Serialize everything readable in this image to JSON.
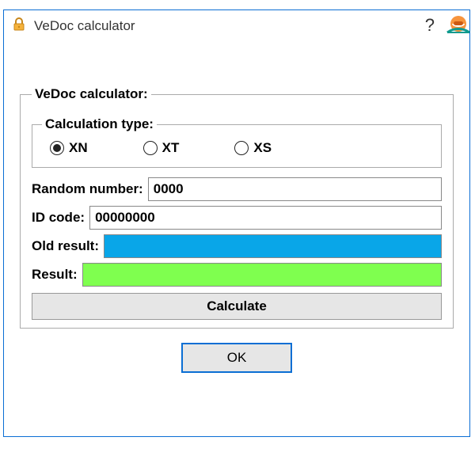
{
  "window": {
    "title": "VeDoc calculator",
    "help": "?"
  },
  "group": {
    "legend": "VeDoc calculator:",
    "calc_type_legend": "Calculation type:",
    "radios": {
      "xn": "XN",
      "xt": "XT",
      "xs": "XS"
    },
    "random_label": "Random number:",
    "random_value": "0000",
    "id_label": "ID code:",
    "id_value": "00000000",
    "old_result_label": "Old result:",
    "result_label": "Result:",
    "calculate": "Calculate"
  },
  "buttons": {
    "ok": "OK"
  }
}
